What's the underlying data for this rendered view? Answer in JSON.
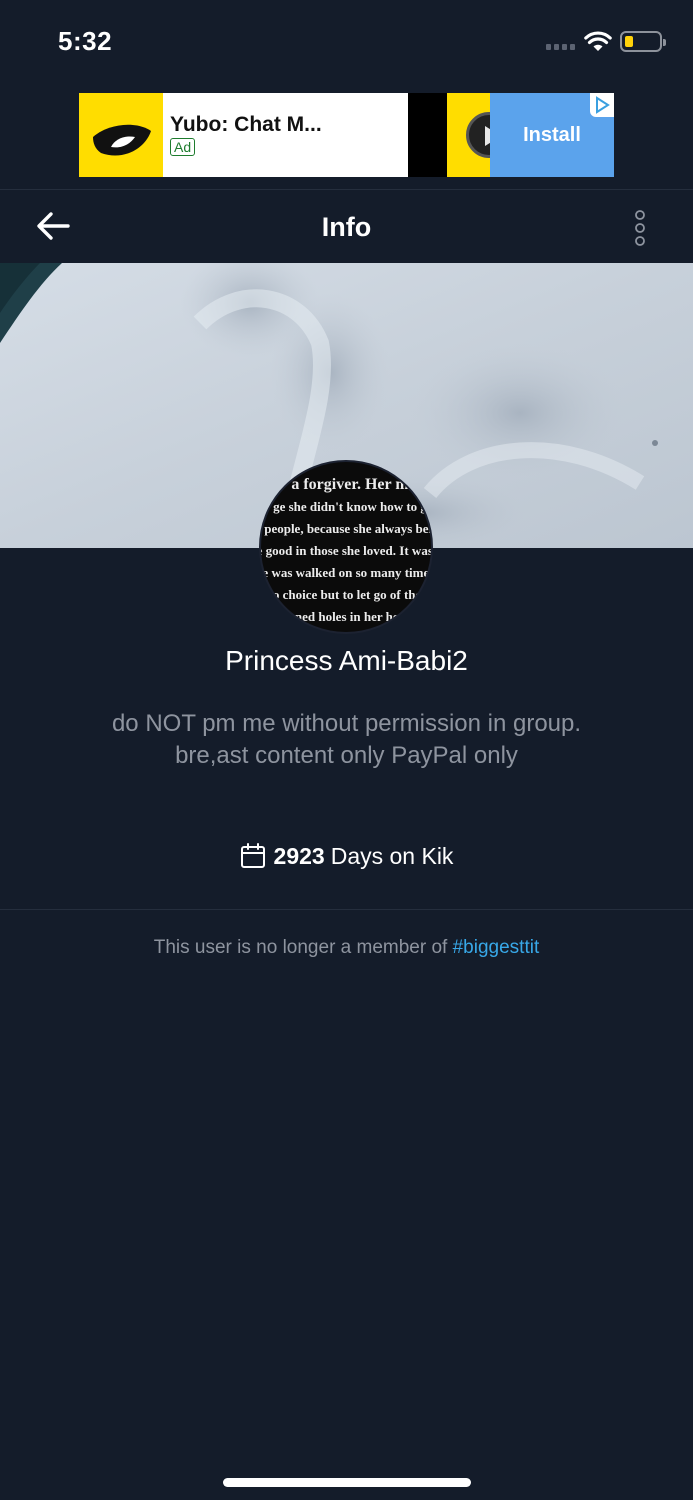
{
  "status_bar": {
    "time": "5:32"
  },
  "ad": {
    "title": "Yubo: Chat M...",
    "badge": "Ad",
    "install_label": "Install"
  },
  "header": {
    "title": "Info"
  },
  "profile": {
    "avatar_text": [
      "a forgiver. Her m",
      "ge she didn't know how to g",
      "people, because she always beli",
      "e good in those she loved. It was u",
      "e was walked on so many times,",
      "o choice but to let go of thos",
      "ned holes in her hea"
    ],
    "display_name": "Princess Ami-Babi2",
    "bio_lines": [
      "do NOT pm me without permission in group.",
      "bre,ast content only PayPal only"
    ],
    "days_count": "2923",
    "days_label": "Days on Kik",
    "member_note_prefix": "This user is no longer a member of ",
    "member_group": "#biggesttit"
  },
  "colors": {
    "background": "#141c2a",
    "link": "#38a8e8",
    "muted_text": "#8e949f",
    "ad_yellow": "#ffdd00",
    "install_blue": "#5ba3ec"
  },
  "icons": [
    "back-arrow-icon",
    "more-vertical-icon",
    "calendar-icon",
    "wifi-icon",
    "battery-icon",
    "signal-icon",
    "play-icon",
    "ad-choices-icon"
  ]
}
